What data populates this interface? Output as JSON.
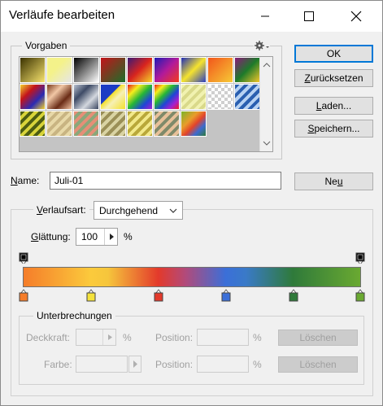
{
  "window": {
    "title": "Verläufe bearbeiten"
  },
  "presets": {
    "label": "Vorgaben"
  },
  "buttons": {
    "ok": "OK",
    "reset": "Zurücksetzen",
    "load": "Laden...",
    "save": "Speichern...",
    "new": "Neu"
  },
  "name": {
    "label": "Name:",
    "value": "Juli-01"
  },
  "gradient_type": {
    "label": "Verlaufsart:",
    "value": "Durchgehend"
  },
  "smoothness": {
    "label": "Glättung:",
    "value": "100",
    "unit": "%"
  },
  "stops": {
    "group_label": "Unterbrechungen",
    "opacity_label": "Deckkraft:",
    "opacity_unit": "%",
    "color_label": "Farbe:",
    "position_label_1": "Position:",
    "position_unit_1": "%",
    "position_label_2": "Position:",
    "position_unit_2": "%",
    "delete_1": "Löschen",
    "delete_2": "Löschen"
  },
  "color_stops": [
    "#f57d2a",
    "#f4e23c",
    "#e33a2b",
    "#3b6fd8",
    "#2f7a3a",
    "#6aa931"
  ],
  "accent": "#0078d7"
}
